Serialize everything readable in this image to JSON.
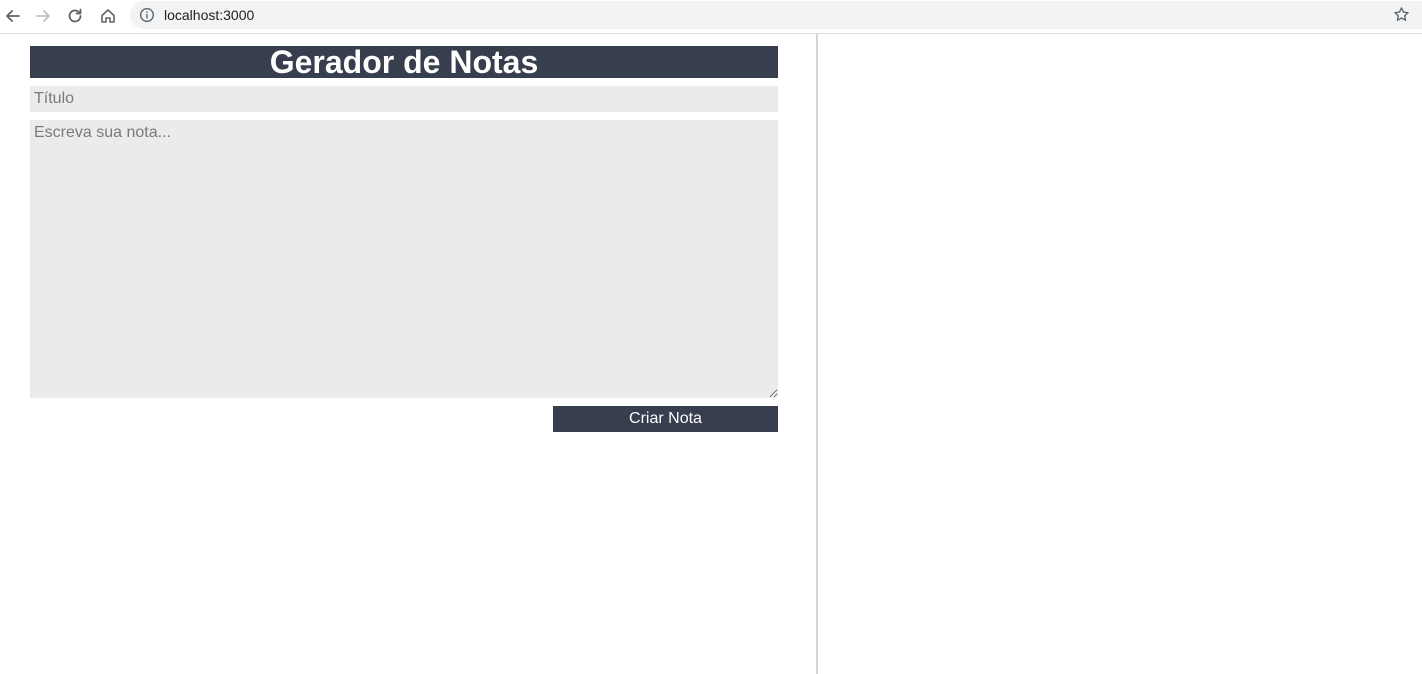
{
  "browser": {
    "url": "localhost:3000",
    "icons": {
      "back": "arrow-left-icon",
      "forward": "arrow-right-icon",
      "reload": "reload-icon",
      "home": "home-icon",
      "info": "info-icon",
      "bookmark": "star-icon"
    }
  },
  "app": {
    "header_title": "Gerador de Notas",
    "title_input": {
      "placeholder": "Título",
      "value": ""
    },
    "note_textarea": {
      "placeholder": "Escreva sua nota...",
      "value": ""
    },
    "create_button_label": "Criar Nota"
  },
  "colors": {
    "accent": "#373e4d",
    "input_background": "#ebebeb",
    "placeholder": "#7a7a7a"
  }
}
